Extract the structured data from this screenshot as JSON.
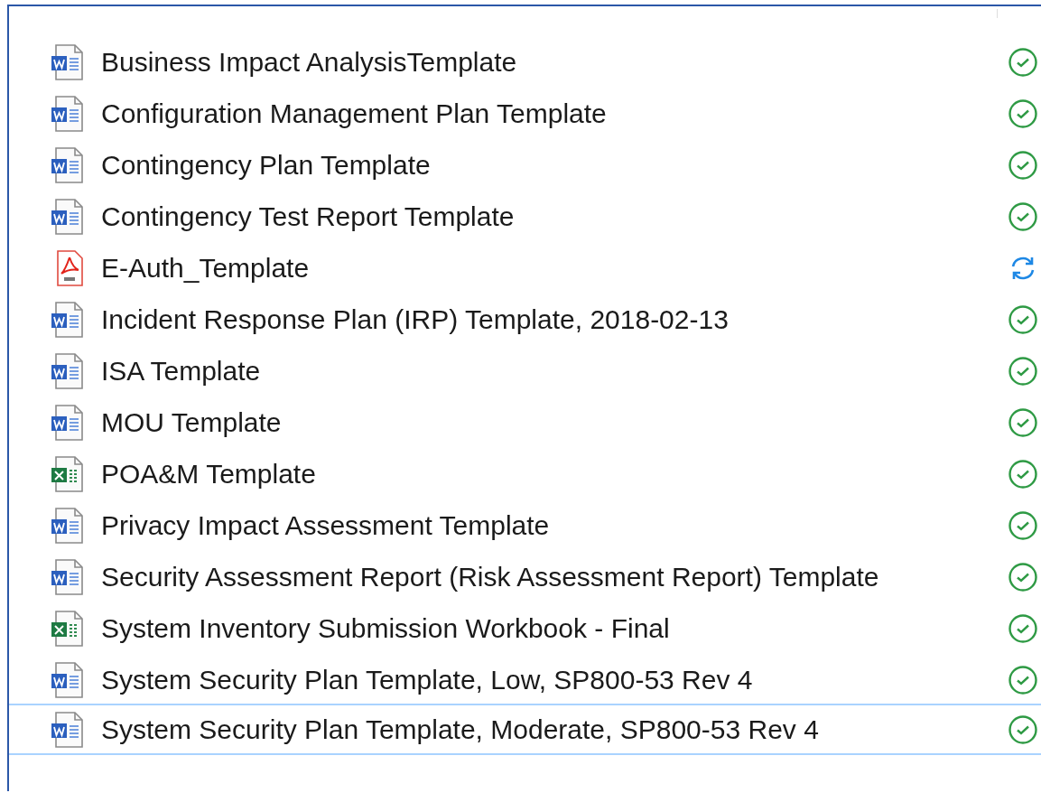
{
  "files": [
    {
      "name": "Business Impact AnalysisTemplate",
      "kind": "word",
      "syncing": false,
      "selected": false
    },
    {
      "name": "Configuration Management Plan Template",
      "kind": "word",
      "syncing": false,
      "selected": false
    },
    {
      "name": "Contingency Plan Template",
      "kind": "word",
      "syncing": false,
      "selected": false
    },
    {
      "name": "Contingency Test Report Template",
      "kind": "word",
      "syncing": false,
      "selected": false
    },
    {
      "name": "E-Auth_Template",
      "kind": "pdf",
      "syncing": true,
      "selected": false
    },
    {
      "name": "Incident Response Plan (IRP) Template, 2018-02-13",
      "kind": "word",
      "syncing": false,
      "selected": false
    },
    {
      "name": "ISA Template",
      "kind": "word",
      "syncing": false,
      "selected": false
    },
    {
      "name": "MOU Template",
      "kind": "word",
      "syncing": false,
      "selected": false
    },
    {
      "name": "POA&M Template",
      "kind": "excel",
      "syncing": false,
      "selected": false
    },
    {
      "name": "Privacy Impact Assessment Template",
      "kind": "word",
      "syncing": false,
      "selected": false
    },
    {
      "name": "Security Assessment Report (Risk Assessment Report) Template",
      "kind": "word",
      "syncing": false,
      "selected": false
    },
    {
      "name": "System Inventory Submission Workbook - Final",
      "kind": "excel",
      "syncing": false,
      "selected": false
    },
    {
      "name": "System Security Plan Template, Low, SP800-53 Rev 4",
      "kind": "word",
      "syncing": false,
      "selected": false
    },
    {
      "name": "System Security Plan Template, Moderate, SP800-53 Rev 4",
      "kind": "word",
      "syncing": false,
      "selected": true
    }
  ]
}
